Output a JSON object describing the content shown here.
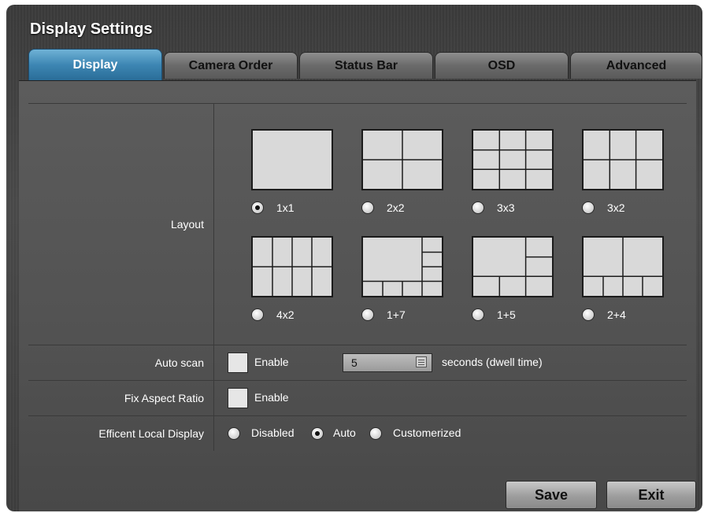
{
  "window": {
    "title": "Display Settings"
  },
  "tabs": [
    {
      "label": "Display",
      "active": true
    },
    {
      "label": "Camera Order",
      "active": false
    },
    {
      "label": "Status Bar",
      "active": false
    },
    {
      "label": "OSD",
      "active": false
    },
    {
      "label": "Advanced",
      "active": false
    }
  ],
  "layout": {
    "label": "Layout",
    "selected": "1x1",
    "options": [
      {
        "label": "1x1",
        "icon": "layout-1x1-icon"
      },
      {
        "label": "2x2",
        "icon": "layout-2x2-icon"
      },
      {
        "label": "3x3",
        "icon": "layout-3x3-icon"
      },
      {
        "label": "3x2",
        "icon": "layout-3x2-icon"
      },
      {
        "label": "4x2",
        "icon": "layout-4x2-icon"
      },
      {
        "label": "1+7",
        "icon": "layout-1plus7-icon"
      },
      {
        "label": "1+5",
        "icon": "layout-1plus5-icon"
      },
      {
        "label": "2+4",
        "icon": "layout-2plus4-icon"
      }
    ]
  },
  "auto_scan": {
    "label": "Auto scan",
    "checkbox_label": "Enable",
    "checked": false,
    "dwell_value": "5",
    "dwell_suffix": "seconds (dwell time)"
  },
  "fix_aspect": {
    "label": "Fix Aspect Ratio",
    "checkbox_label": "Enable",
    "checked": false
  },
  "local_display": {
    "label": "Efficent Local Display",
    "options": [
      "Disabled",
      "Auto",
      "Customerized"
    ],
    "selected": "Auto"
  },
  "buttons": {
    "save": "Save",
    "exit": "Exit"
  },
  "colors": {
    "active_tab": "#3d86b3",
    "panel": "#555555"
  }
}
